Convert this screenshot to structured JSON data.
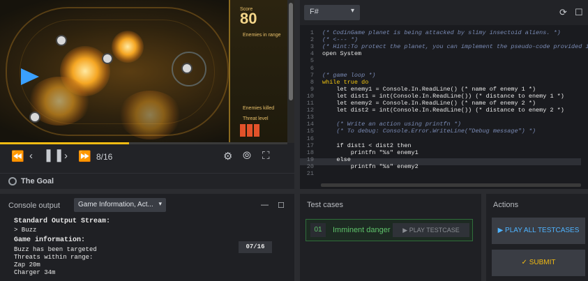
{
  "viewer": {
    "hud": {
      "score_label": "Score",
      "score_value": "80",
      "enemies_in_range_label": "Enemies in range",
      "enemies_killed_label": "Enemies killed",
      "threat_level_label": "Threat level"
    },
    "progress": 0.45,
    "frame_counter": "8/16",
    "goal_label": "The Goal"
  },
  "editor": {
    "language": "F#",
    "lines": [
      {
        "n": "1",
        "text": "(* CodinGame planet is being attacked by slimy insectoid aliens. *)",
        "cls": "cmt"
      },
      {
        "n": "2",
        "text": "(* <--- *)",
        "cls": "cmt"
      },
      {
        "n": "3",
        "text": "(* Hint:To protect the planet, you can implement the pseudo-code provided in t",
        "cls": "cmt"
      },
      {
        "n": "4",
        "text": "open System",
        "cls": ""
      },
      {
        "n": "5",
        "text": "",
        "cls": ""
      },
      {
        "n": "6",
        "text": "",
        "cls": ""
      },
      {
        "n": "7",
        "text": "(* game loop *)",
        "cls": "cmt"
      },
      {
        "n": "8",
        "text": "while true do",
        "cls": "kw"
      },
      {
        "n": "9",
        "text": "    let enemy1 = Console.In.ReadLine() (* name of enemy 1 *)",
        "cls": ""
      },
      {
        "n": "10",
        "text": "    let dist1 = int(Console.In.ReadLine()) (* distance to enemy 1 *)",
        "cls": ""
      },
      {
        "n": "11",
        "text": "    let enemy2 = Console.In.ReadLine() (* name of enemy 2 *)",
        "cls": ""
      },
      {
        "n": "12",
        "text": "    let dist2 = int(Console.In.ReadLine()) (* distance to enemy 2 *)",
        "cls": ""
      },
      {
        "n": "13",
        "text": "",
        "cls": ""
      },
      {
        "n": "14",
        "text": "    (* Write an action using printfn *)",
        "cls": "cmt"
      },
      {
        "n": "15",
        "text": "    (* To debug: Console.Error.WriteLine(\"Debug message\") *)",
        "cls": "cmt"
      },
      {
        "n": "16",
        "text": "",
        "cls": ""
      },
      {
        "n": "17",
        "text": "    if dist1 < dist2 then",
        "cls": ""
      },
      {
        "n": "18",
        "text": "        printfn \"%s\" enemy1",
        "cls": ""
      },
      {
        "n": "19",
        "text": "    else",
        "cls": ""
      },
      {
        "n": "20",
        "text": "        printfn \"%s\" enemy2",
        "cls": ""
      },
      {
        "n": "21",
        "text": "",
        "cls": ""
      }
    ]
  },
  "console": {
    "title": "Console output",
    "select_value": "Game Information, Act...",
    "stdout_header": "Standard Output Stream:",
    "stdout_line": "> Buzz",
    "game_header": "Game information:",
    "game_lines": [
      "Buzz has been targeted",
      "Threats within range:",
      "Zap 20m",
      "Charger 34m"
    ],
    "turn_badge": "07/16"
  },
  "tests": {
    "title": "Test cases",
    "items": [
      {
        "num": "01",
        "name": "Imminent danger",
        "play_label": "▶ PLAY TESTCASE"
      }
    ]
  },
  "actions": {
    "title": "Actions",
    "play_all_label": "▶ PLAY ALL TESTCASES",
    "submit_label": "✓ SUBMIT"
  }
}
